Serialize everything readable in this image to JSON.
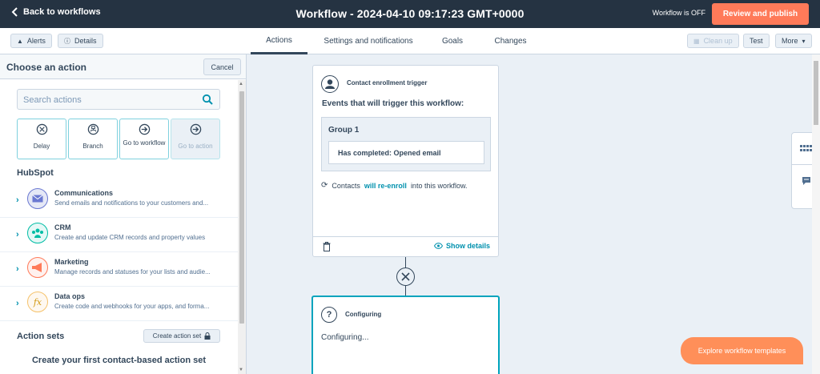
{
  "topbar": {
    "back_label": "Back to workflows",
    "title": "Workflow - 2024-04-10 09:17:23 GMT+0000",
    "status": "Workflow is OFF",
    "publish_label": "Review and publish"
  },
  "subbar": {
    "alerts_label": "Alerts",
    "details_label": "Details",
    "tabs": [
      {
        "label": "Actions",
        "active": true
      },
      {
        "label": "Settings and notifications",
        "active": false
      },
      {
        "label": "Goals",
        "active": false
      },
      {
        "label": "Changes",
        "active": false
      }
    ],
    "cleanup_label": "Clean up",
    "test_label": "Test",
    "more_label": "More"
  },
  "panel": {
    "title": "Choose an action",
    "cancel_label": "Cancel",
    "search_placeholder": "Search actions",
    "quick_actions": [
      {
        "label": "Delay",
        "icon": "clock-icon"
      },
      {
        "label": "Branch",
        "icon": "branch-icon"
      },
      {
        "label": "Go to workflow",
        "icon": "arrow-right-circle-icon"
      },
      {
        "label": "Go to action",
        "icon": "arrow-right-circle-icon",
        "disabled": true
      }
    ],
    "section_title": "HubSpot",
    "categories": [
      {
        "name": "Communications",
        "desc": "Send emails and notifications to your customers and...",
        "icon": "email-icon",
        "color": "#6a78d1"
      },
      {
        "name": "CRM",
        "desc": "Create and update CRM records and property values",
        "icon": "people-icon",
        "color": "#00bda5"
      },
      {
        "name": "Marketing",
        "desc": "Manage records and statuses for your lists and audie...",
        "icon": "megaphone-icon",
        "color": "#ff7a59"
      },
      {
        "name": "Data ops",
        "desc": "Create code and webhooks for your apps, and forma...",
        "icon": "function-icon",
        "color": "#f5c26b"
      }
    ],
    "action_sets_title": "Action sets",
    "create_action_set_label": "Create action set",
    "first_set_title": "Create your first contact-based action set"
  },
  "canvas": {
    "trigger_card": {
      "title": "Contact enrollment trigger",
      "events_title": "Events that will trigger this workflow:",
      "group_title": "Group 1",
      "condition": "Has completed: Opened email",
      "reenroll_pre": "Contacts",
      "reenroll_link": "will re-enroll",
      "reenroll_post": "into this workflow.",
      "show_details": "Show details"
    },
    "config_card": {
      "title": "Configuring",
      "body": "Configuring..."
    },
    "explore_label": "Explore workflow templates"
  },
  "colors": {
    "topbar": "#253342",
    "accent": "#ff7a59",
    "teal": "#0091ae"
  }
}
